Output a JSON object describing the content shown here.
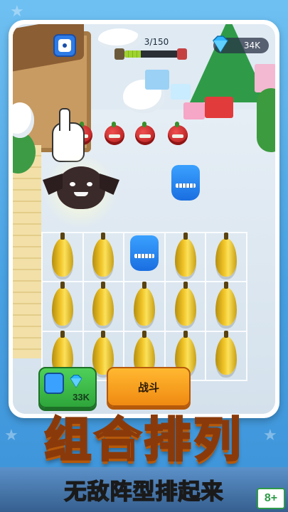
{
  "hud": {
    "level_text": "3/150",
    "progress_fraction": 0.3,
    "gems": "34K"
  },
  "shop": {
    "buy_price": "33K"
  },
  "battle": {
    "fight_label": "战斗"
  },
  "promo": {
    "title": "组合排列",
    "subtitle": "无敌阵型排起来",
    "age_rating": "8+"
  },
  "colors": {
    "gem": "#2fb6ff",
    "buy_button": "#2ea63a",
    "fight_button": "#f08a12",
    "title_text": "#ffd24a"
  },
  "icons": {
    "menu_button": "monster-face-icon",
    "currency": "diamond-icon"
  },
  "board": {
    "rows": 3,
    "cols": 5,
    "cells": [
      [
        "banana",
        "banana",
        "blue-monster",
        "banana",
        "banana"
      ],
      [
        "banana",
        "banana",
        "banana",
        "banana",
        "banana"
      ],
      [
        "banana",
        "banana",
        "banana",
        "banana",
        "banana"
      ]
    ],
    "enemies": [
      "apple-monster",
      "apple-monster",
      "apple-monster",
      "apple-monster"
    ]
  }
}
